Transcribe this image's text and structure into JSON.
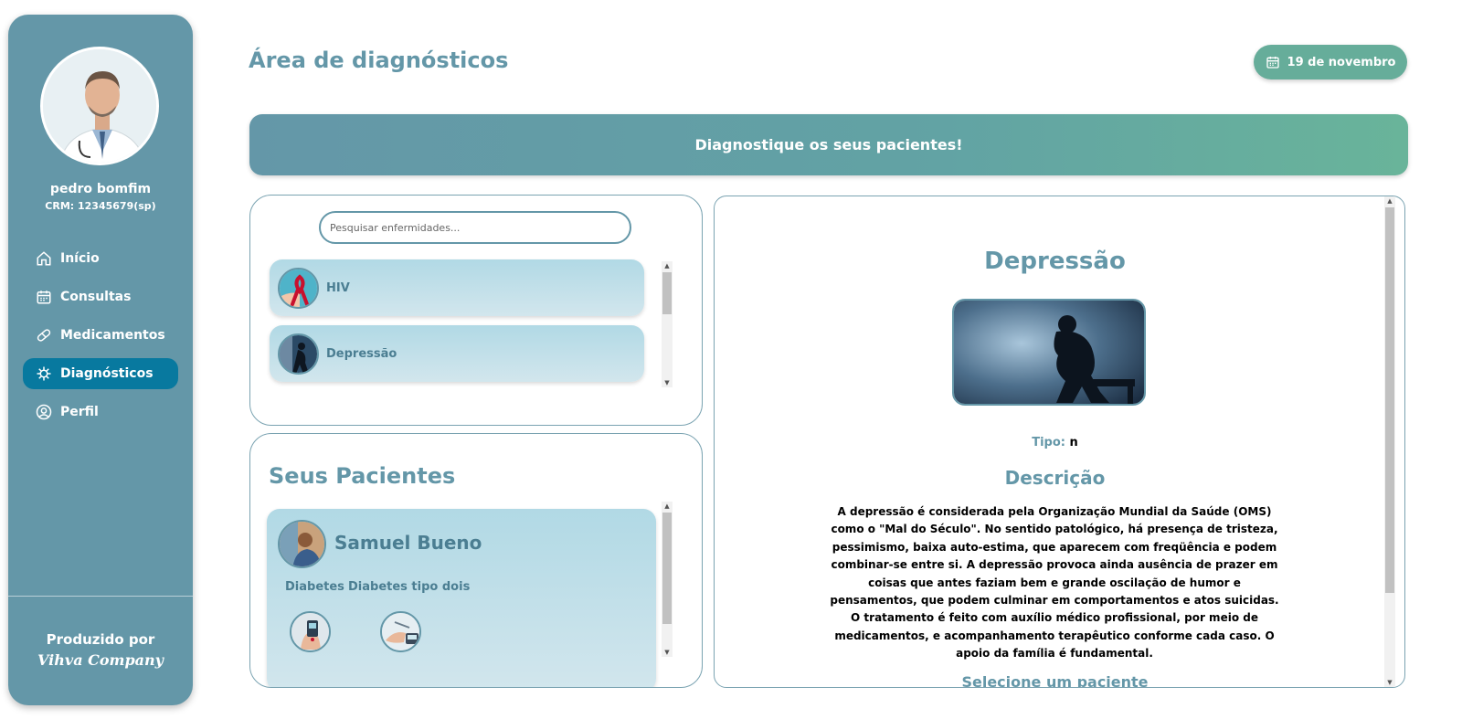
{
  "sidebar": {
    "doctor_name": "pedro bomfim",
    "crm": "CRM: 12345679(sp)",
    "items": [
      {
        "label": "Início",
        "icon": "home-icon",
        "active": false
      },
      {
        "label": "Consultas",
        "icon": "calendar-icon",
        "active": false
      },
      {
        "label": "Medicamentos",
        "icon": "pill-icon",
        "active": false
      },
      {
        "label": "Diagnósticos",
        "icon": "virus-icon",
        "active": true
      },
      {
        "label": "Perfil",
        "icon": "user-circle-icon",
        "active": false
      }
    ],
    "produced_by": "Produzido por",
    "company": "Vihva Company"
  },
  "header": {
    "title": "Área de diagnósticos",
    "date": "19 de novembro"
  },
  "banner": {
    "text": "Diagnostique os seus pacientes!"
  },
  "search": {
    "placeholder": "Pesquisar enfermidades..."
  },
  "diseases": [
    {
      "name": "HIV"
    },
    {
      "name": "Depressão"
    }
  ],
  "patients": {
    "title": "Seus Pacientes",
    "items": [
      {
        "name": "Samuel Bueno",
        "conditions": [
          "Diabetes",
          "Diabetes tipo dois"
        ]
      }
    ]
  },
  "detail": {
    "title": "Depressão",
    "type_label": "Tipo:",
    "type_value": "n",
    "description_title": "Descrição",
    "description": "A depressão é considerada pela Organização Mundial da Saúde (OMS) como o \"Mal do Século\". No sentido patológico, há presença de tristeza, pessimismo, baixa auto-estima, que aparecem com freqüência e podem combinar-se entre si. A depressão provoca ainda ausência de prazer em coisas que antes faziam bem e grande oscilação de humor e pensamentos, que podem culminar em comportamentos e atos suicidas. O tratamento é feito com auxílio médico profissional, por meio de medicamentos, e acompanhamento terapêutico conforme cada caso. O apoio da família é fundamental.",
    "select_patient": "Selecione um paciente"
  },
  "colors": {
    "primary": "#6497a8",
    "active_nav": "#08799f",
    "accent_green": "#66ad9a",
    "card_bg": "#b1d9e5"
  }
}
